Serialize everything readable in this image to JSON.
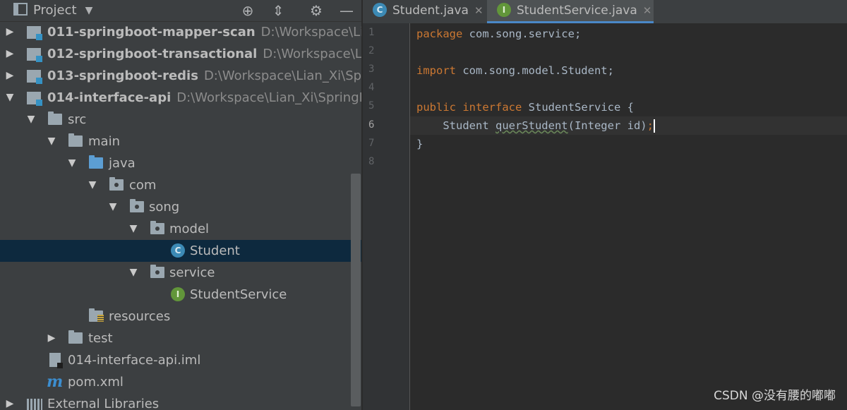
{
  "project_panel": {
    "title": "Project",
    "icons": [
      "dropdown-caret-icon",
      "locate-icon",
      "collapse-all-icon",
      "settings-gear-icon",
      "hide-icon"
    ]
  },
  "tree": [
    {
      "label": "011-springboot-mapper-scan",
      "path": "D:\\Workspace\\Lian_Xi\\S",
      "type": "module",
      "expanded": false
    },
    {
      "label": "012-springboot-transactional",
      "path": "D:\\Workspace\\Lian_Xi\\S",
      "type": "module",
      "expanded": false
    },
    {
      "label": "013-springboot-redis",
      "path": "D:\\Workspace\\Lian_Xi\\SpringBo",
      "type": "module",
      "expanded": false
    },
    {
      "label": "014-interface-api",
      "path": "D:\\Workspace\\Lian_Xi\\SpringBootS\\",
      "type": "module",
      "expanded": true
    },
    {
      "label": "src",
      "type": "folder",
      "expanded": true
    },
    {
      "label": "main",
      "type": "folder",
      "expanded": true
    },
    {
      "label": "java",
      "type": "source-folder",
      "expanded": true
    },
    {
      "label": "com",
      "type": "package",
      "expanded": true
    },
    {
      "label": "song",
      "type": "package",
      "expanded": true
    },
    {
      "label": "model",
      "type": "package",
      "expanded": true
    },
    {
      "label": "Student",
      "type": "class",
      "selected": true
    },
    {
      "label": "service",
      "type": "package",
      "expanded": true
    },
    {
      "label": "StudentService",
      "type": "interface"
    },
    {
      "label": "resources",
      "type": "resources-folder"
    },
    {
      "label": "test",
      "type": "folder",
      "expanded": false
    },
    {
      "label": "014-interface-api.iml",
      "type": "iml-file"
    },
    {
      "label": "pom.xml",
      "type": "maven-file"
    },
    {
      "label": "External Libraries",
      "type": "libraries"
    }
  ],
  "editor": {
    "tabs": [
      {
        "label": "Student.java",
        "icon": "class-icon",
        "active": false
      },
      {
        "label": "StudentService.java",
        "icon": "interface-icon",
        "active": true
      }
    ],
    "line_numbers": [
      "1",
      "2",
      "3",
      "4",
      "5",
      "6",
      "7",
      "8"
    ],
    "current_line": 6,
    "code": {
      "l1_kw": "package",
      "l1_rest": " com.song.service;",
      "l3_kw": "import",
      "l3_rest": " com.song.model.Student;",
      "l5_kw1": "public",
      "l5_kw2": "interface",
      "l5_rest": " StudentService {",
      "l6_indent": "    Student ",
      "l6_method": "querStudent",
      "l6_rest": "(Integer id)",
      "l6_semi": ";",
      "l7": "}"
    }
  },
  "watermark": "CSDN @没有腰的嘟嘟",
  "colors": {
    "keyword": "#cc7832",
    "text": "#a9b7c6",
    "selection": "#0d293e",
    "panel": "#3c3f41",
    "editor": "#2b2b2b"
  }
}
